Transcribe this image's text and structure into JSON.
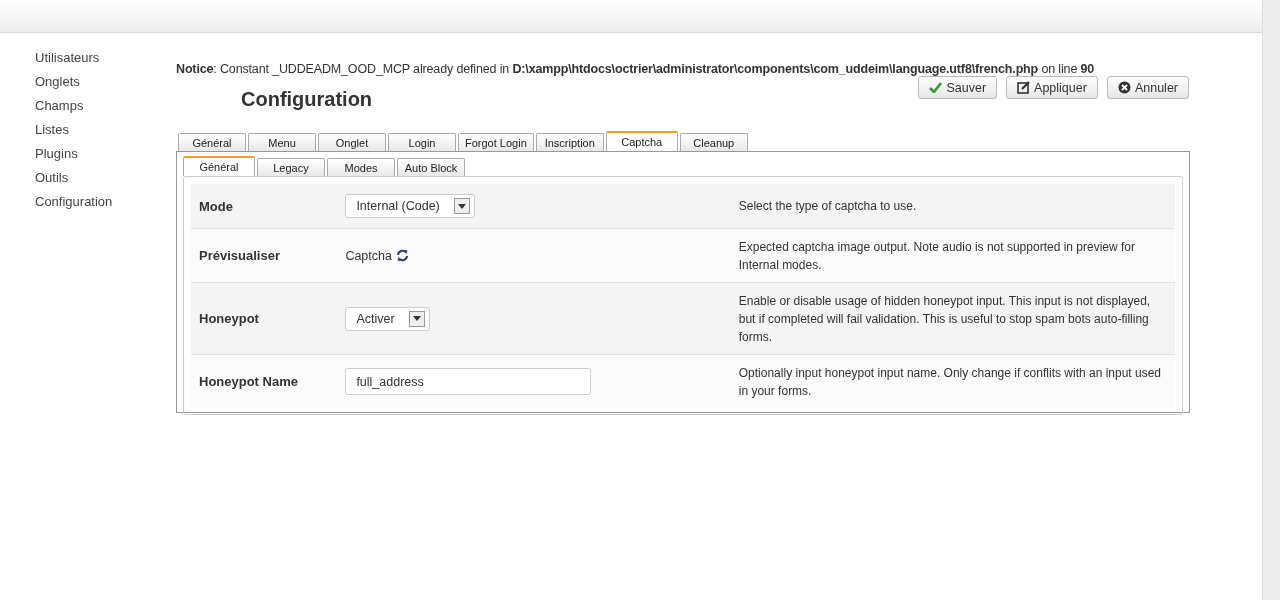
{
  "sidebar": {
    "items": [
      {
        "label": "Utilisateurs"
      },
      {
        "label": "Onglets"
      },
      {
        "label": "Champs"
      },
      {
        "label": "Listes"
      },
      {
        "label": "Plugins"
      },
      {
        "label": "Outils"
      },
      {
        "label": "Configuration"
      }
    ]
  },
  "notice": "**Notice**: Constant _UDDEADM_OOD_MCP already defined in **D:\\xampp\\htdocs\\octrier\\administrator\\components\\com_uddeim\\language.utf8\\french.php** on line **90**",
  "title": "Configuration",
  "buttons": [
    {
      "label": "Sauver",
      "kind": "check"
    },
    {
      "label": "Appliquer",
      "kind": "edit"
    },
    {
      "label": "Annuler",
      "kind": "cancel"
    }
  ],
  "tabs": [
    {
      "label": "Général",
      "selected": false
    },
    {
      "label": "Menu",
      "selected": false
    },
    {
      "label": "Onglet",
      "selected": false
    },
    {
      "label": "Login",
      "selected": false
    },
    {
      "label": "Forgot Login",
      "selected": false
    },
    {
      "label": "Inscription",
      "selected": false
    },
    {
      "label": "Captcha",
      "selected": true
    },
    {
      "label": "Cleanup",
      "selected": false
    }
  ],
  "subtabs": [
    {
      "label": "Général",
      "selected": true
    },
    {
      "label": "Legacy",
      "selected": false
    },
    {
      "label": "Modes",
      "selected": false
    },
    {
      "label": "Auto Block",
      "selected": false
    }
  ],
  "rows": [
    {
      "label": "Mode",
      "kind": "select",
      "value": "Internal (Code)",
      "description": "Select the type of captcha to use."
    },
    {
      "label": "Prévisualiser",
      "kind": "preview",
      "value": "Captcha",
      "description": "Expected captcha image output. Note audio is not supported in preview for Internal modes."
    },
    {
      "label": "Honeypot",
      "kind": "select",
      "value": "Activer",
      "description": "Enable or disable usage of hidden honeypot input. This input is not displayed, but if completed will fail validation. This is useful to stop spam bots auto-filling forms."
    },
    {
      "label": "Honeypot Name",
      "kind": "text",
      "value": "full_address",
      "description": "Optionally input honeypot input name. Only change if conflits with an input used in your forms."
    }
  ]
}
